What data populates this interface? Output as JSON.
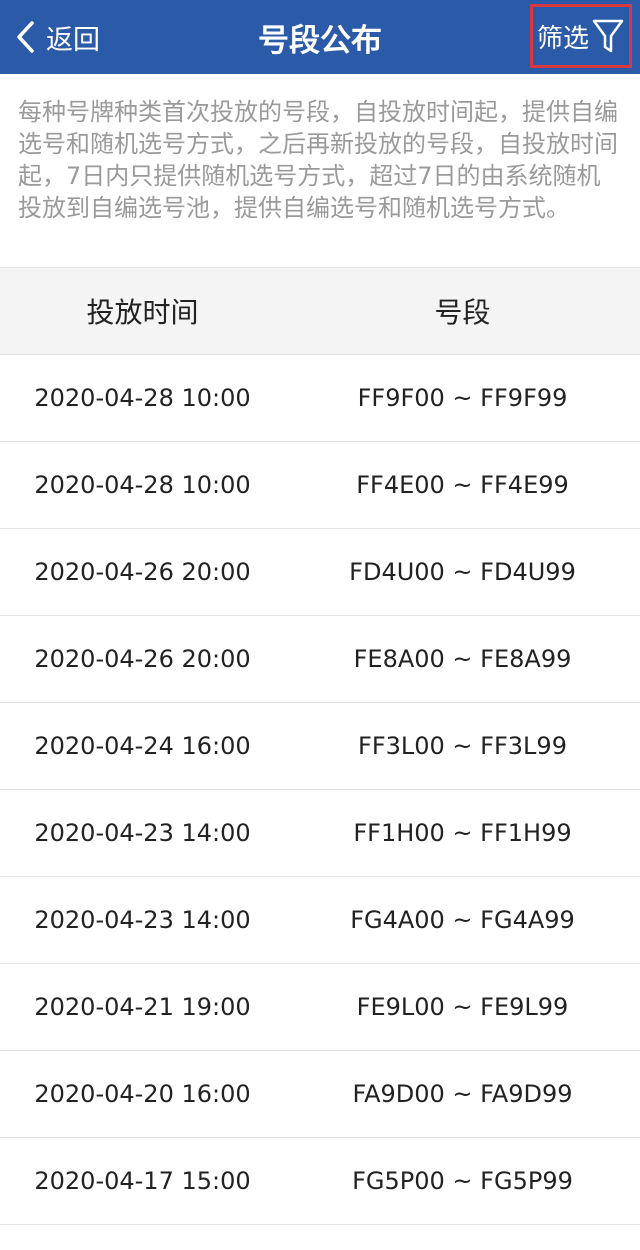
{
  "header": {
    "back_label": "返回",
    "title": "号段公布",
    "filter_label": "筛选"
  },
  "notice": "每种号牌种类首次投放的号段，自投放时间起，提供自编选号和随机选号方式，之后再新投放的号段，自投放时间起，7日内只提供随机选号方式，超过7日的由系统随机投放到自编选号池，提供自编选号和随机选号方式。",
  "table": {
    "headers": [
      "投放时间",
      "号段"
    ],
    "rows": [
      {
        "time": "2020-04-28 10:00",
        "segment": "FF9F00 ~ FF9F99"
      },
      {
        "time": "2020-04-28 10:00",
        "segment": "FF4E00 ~ FF4E99"
      },
      {
        "time": "2020-04-26 20:00",
        "segment": "FD4U00 ~ FD4U99"
      },
      {
        "time": "2020-04-26 20:00",
        "segment": "FE8A00 ~ FE8A99"
      },
      {
        "time": "2020-04-24 16:00",
        "segment": "FF3L00 ~ FF3L99"
      },
      {
        "time": "2020-04-23 14:00",
        "segment": "FF1H00 ~ FF1H99"
      },
      {
        "time": "2020-04-23 14:00",
        "segment": "FG4A00 ~ FG4A99"
      },
      {
        "time": "2020-04-21 19:00",
        "segment": "FE9L00 ~ FE9L99"
      },
      {
        "time": "2020-04-20 16:00",
        "segment": "FA9D00 ~ FA9D99"
      },
      {
        "time": "2020-04-17 15:00",
        "segment": "FG5P00 ~ FG5P99"
      }
    ]
  },
  "icons": {
    "back": "chevron-left-icon",
    "filter": "funnel-icon"
  },
  "colors": {
    "header_bg": "#2b5aa8",
    "filter_highlight": "#d8383f",
    "notice_text": "#9a9a9a"
  }
}
